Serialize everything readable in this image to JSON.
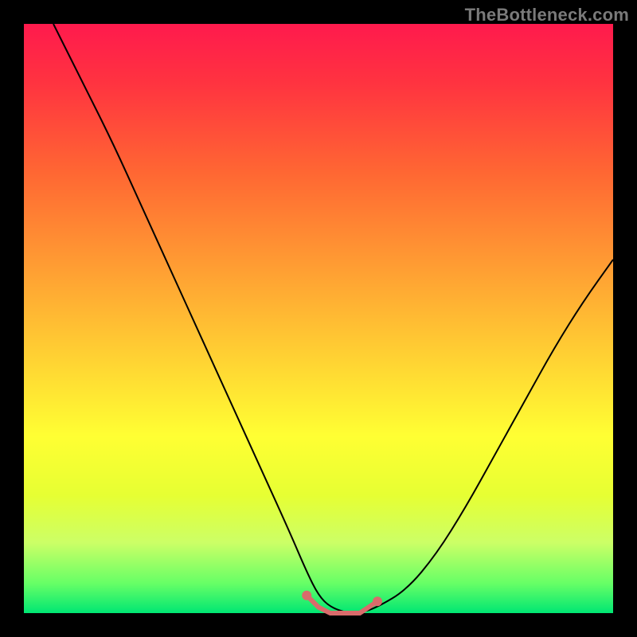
{
  "watermark": "TheBottleneck.com",
  "chart_data": {
    "type": "line",
    "title": "",
    "xlabel": "",
    "ylabel": "",
    "xlim": [
      0,
      100
    ],
    "ylim": [
      0,
      100
    ],
    "grid": false,
    "legend": false,
    "series": [
      {
        "name": "bottleneck-curve",
        "color": "#000000",
        "x": [
          5,
          10,
          15,
          20,
          25,
          30,
          35,
          40,
          45,
          48,
          50,
          52,
          55,
          57,
          60,
          65,
          70,
          75,
          80,
          85,
          90,
          95,
          100
        ],
        "y": [
          100,
          90,
          80,
          69,
          58,
          47,
          36,
          25,
          14,
          7,
          3,
          1,
          0,
          0,
          1,
          4,
          10,
          18,
          27,
          36,
          45,
          53,
          60
        ]
      },
      {
        "name": "optimal-range",
        "color": "#d96b6b",
        "x": [
          48,
          50,
          52,
          55,
          57,
          60
        ],
        "y": [
          3,
          1,
          0,
          0,
          0,
          2
        ]
      }
    ],
    "markers": [
      {
        "name": "optimal-start",
        "x": 48,
        "y": 3,
        "color": "#d96b6b"
      },
      {
        "name": "optimal-end",
        "x": 60,
        "y": 2,
        "color": "#d96b6b"
      }
    ],
    "annotations": []
  }
}
